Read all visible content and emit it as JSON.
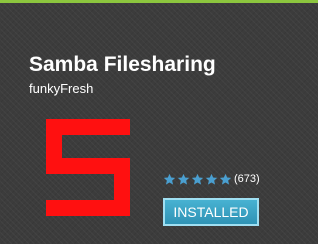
{
  "app": {
    "title": "Samba Filesharing",
    "developer": "funkyFresh",
    "logo_icon": "samba-s-logo-icon",
    "logo_color": "#ff1010"
  },
  "rating": {
    "stars": 5,
    "star_icon": "star-icon",
    "star_color": "#4a9fd0",
    "count_label": "(673)"
  },
  "install_button": {
    "label": "INSTALLED",
    "color": "#3aa3c6"
  },
  "theme": {
    "background": "#3c3c3c",
    "accent_border": "#8cc63e"
  }
}
